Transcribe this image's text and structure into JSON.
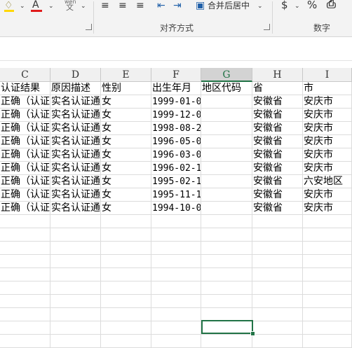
{
  "ribbon": {
    "font_color_letter": "A",
    "wen_top": "wén",
    "wen_char": "文",
    "align_title": "对齐方式",
    "merge_label": "合并后居中",
    "number_title": "数字",
    "currency_symbol": "$",
    "percent_symbol": "%"
  },
  "sheet": {
    "columns": [
      "C",
      "D",
      "E",
      "F",
      "G",
      "H",
      "I"
    ],
    "selected_column": "G",
    "header_row": [
      "认证结果",
      "原因描述",
      "性别",
      "出生年月",
      "地区代码",
      "省",
      "市"
    ],
    "rows": [
      [
        "正确（认证",
        "实名认证通",
        "女",
        "1999-01-0",
        "",
        "安徽省",
        "安庆市"
      ],
      [
        "正确（认证",
        "实名认证通",
        "女",
        "1999-12-0",
        "",
        "安徽省",
        "安庆市"
      ],
      [
        "正确（认证",
        "实名认证通",
        "女",
        "1998-08-2",
        "",
        "安徽省",
        "安庆市"
      ],
      [
        "正确（认证",
        "实名认证通",
        "女",
        "1996-05-0",
        "",
        "安徽省",
        "安庆市"
      ],
      [
        "正确（认证",
        "实名认证通",
        "女",
        "1996-03-0",
        "",
        "安徽省",
        "安庆市"
      ],
      [
        "正确（认证",
        "实名认证通",
        "女",
        "1996-02-1",
        "",
        "安徽省",
        "安庆市"
      ],
      [
        "正确（认证",
        "实名认证通",
        "女",
        "1995-02-1",
        "",
        "安徽省",
        "六安地区"
      ],
      [
        "正确（认证",
        "实名认证通",
        "女",
        "1995-11-1",
        "",
        "安徽省",
        "安庆市"
      ],
      [
        "正确（认证",
        "实名认证通",
        "女",
        "1994-10-0",
        "",
        "安徽省",
        "安庆市"
      ]
    ]
  },
  "colors": {
    "accent": "#217346",
    "font_color": "#e01b1b",
    "fill_color": "#ffd700"
  }
}
